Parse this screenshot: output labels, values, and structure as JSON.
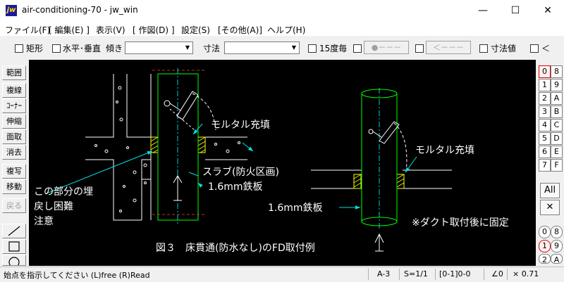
{
  "window": {
    "app_icon": "jw",
    "title": "air-conditioning-70 - jw_win",
    "minimize": "—",
    "maximize": "☐",
    "close": "✕"
  },
  "menu": [
    "ファイル(F)",
    "[ 編集(E) ]",
    "表示(V)",
    "[ 作図(D) ]",
    "設定(S)",
    "[その他(A)]",
    "ヘルプ(H)"
  ],
  "toolbar": {
    "rect_label": "矩形",
    "hv_label": "水平･垂直",
    "tilt_label": "傾き",
    "dim_label": "寸法",
    "deg15_label": "15度毎",
    "dot_btn": "●－－－",
    "arrow_btn": "＜－－－",
    "dimval_label": "寸法値",
    "lt_label": "＜"
  },
  "left_tools": [
    "範囲",
    "複線",
    "ｺｰﾅｰ",
    "伸縮",
    "面取",
    "消去",
    "複写",
    "移動",
    "戻る"
  ],
  "right_panel": {
    "layers_top": [
      "0",
      "8",
      "1",
      "9",
      "2",
      "A",
      "3",
      "B",
      "4",
      "C",
      "5",
      "D",
      "6",
      "E",
      "7",
      "F"
    ],
    "all_label": "All",
    "x_label": "✕",
    "layers_bottom": [
      "0",
      "8",
      "1",
      "9",
      "2",
      "A"
    ]
  },
  "drawing": {
    "mortar_left": "モルタル充填",
    "mortar_right": "モルタル充填",
    "slab": "スラブ(防火区画)",
    "steel_left": "1.6mm鉄板",
    "steel_right": "1.6mm鉄板",
    "note1": "この部分の埋",
    "note2": "戻し困難",
    "note3": "注意",
    "duct_note": "※ダクト取付後に固定",
    "caption": "図３　床貫通(防水なし)のFD取付例"
  },
  "status": {
    "prompt": "始点を指示してください (L)free (R)Read",
    "paper": "A-3",
    "scale": "S=1/1",
    "layer": "[0-1]0-0",
    "angle": "∠0",
    "factor": "× 0.71"
  }
}
